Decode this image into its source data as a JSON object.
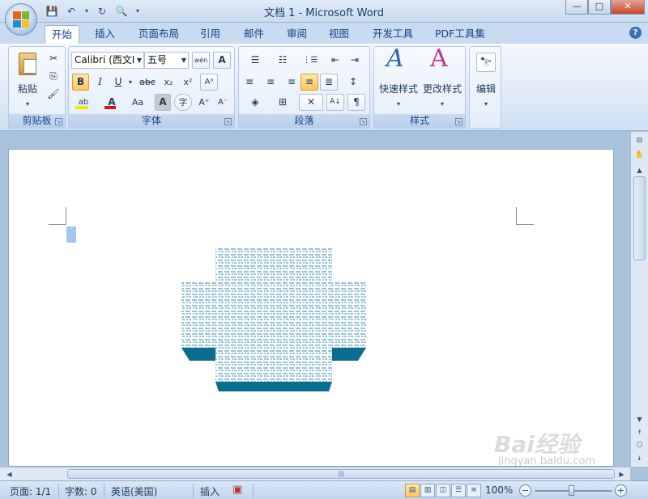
{
  "window": {
    "title": "文档 1 - Microsoft Word",
    "minimize": "—",
    "maximize": "□",
    "close": "✕"
  },
  "quick_access": {
    "save_icon": "💾",
    "undo_icon": "↶",
    "undo_arrow": "▾",
    "redo_icon": "↻",
    "print_preview_icon": "🔍",
    "customize_arrow": "▾"
  },
  "tabs": [
    "开始",
    "插入",
    "页面布局",
    "引用",
    "邮件",
    "审阅",
    "视图",
    "开发工具",
    "PDF工具集"
  ],
  "active_tab": "开始",
  "help_label": "?",
  "ribbon": {
    "clipboard": {
      "label": "剪贴板",
      "paste": "粘贴",
      "paste_arrow": "▾",
      "cut_icon": "✂",
      "copy_icon": "⎘",
      "format_painter_icon": "🖌"
    },
    "font": {
      "label": "字体",
      "font_name": "Calibri (西文I",
      "font_size": "五号",
      "phonetic": "wén",
      "char_border": "A",
      "bold": "B",
      "italic": "I",
      "underline": "U",
      "underline_arrow": "▾",
      "strikethrough": "abc",
      "subscript": "x₂",
      "superscript": "x²",
      "clear_format": "Aᵃ",
      "highlight": "ab",
      "font_color": "A",
      "change_case": "Aa",
      "char_shading": "A",
      "enclose_char": "字",
      "grow_font": "A⁺",
      "shrink_font": "A⁻",
      "highlight_color": "#f5e600",
      "font_color_value": "#d01818"
    },
    "paragraph": {
      "label": "段落",
      "bullets": "☰",
      "numbering": "☷",
      "multilevel": "⋮☰",
      "decrease_indent": "⇤",
      "increase_indent": "⇥",
      "align_left": "≡",
      "align_center": "≡",
      "align_right": "≡",
      "justify": "≡",
      "distributed": "≣",
      "line_spacing": "↕",
      "shading": "◈",
      "borders": "⊞",
      "chinese_layout": "✕",
      "sort": "A↓",
      "show_marks": "¶"
    },
    "styles": {
      "label": "样式",
      "quick_styles": "快速样式",
      "change_styles": "更改样式",
      "quick_styles_icon": "A",
      "change_styles_icon": "A"
    },
    "editing": {
      "label": "编辑",
      "find_icon": "🔭"
    }
  },
  "status": {
    "page": "页面: 1/1",
    "word_count": "字数: 0",
    "language": "英语(美国)",
    "mode": "插入",
    "macro_icon": "▣",
    "zoom": "100%",
    "zoom_out": "−",
    "zoom_in": "+",
    "zoom_level": 0.5
  },
  "scroll": {
    "up": "▲",
    "down": "▼",
    "left": "◀",
    "right": "▶",
    "prev_page": "⯭",
    "select_browse": "○",
    "next_page": "⯯",
    "ruler_toggle": "⊟",
    "pan": "✋",
    "hthumb_grip": "|||"
  },
  "watermark": {
    "brand": "Bai经验",
    "url": "jingyan.baidu.com"
  },
  "colors": {
    "shape_fill_pattern": "#2f89b0",
    "shape_shadow": "#0b6d8f",
    "selection": "#a6c7ee",
    "accent": "#15428b"
  }
}
